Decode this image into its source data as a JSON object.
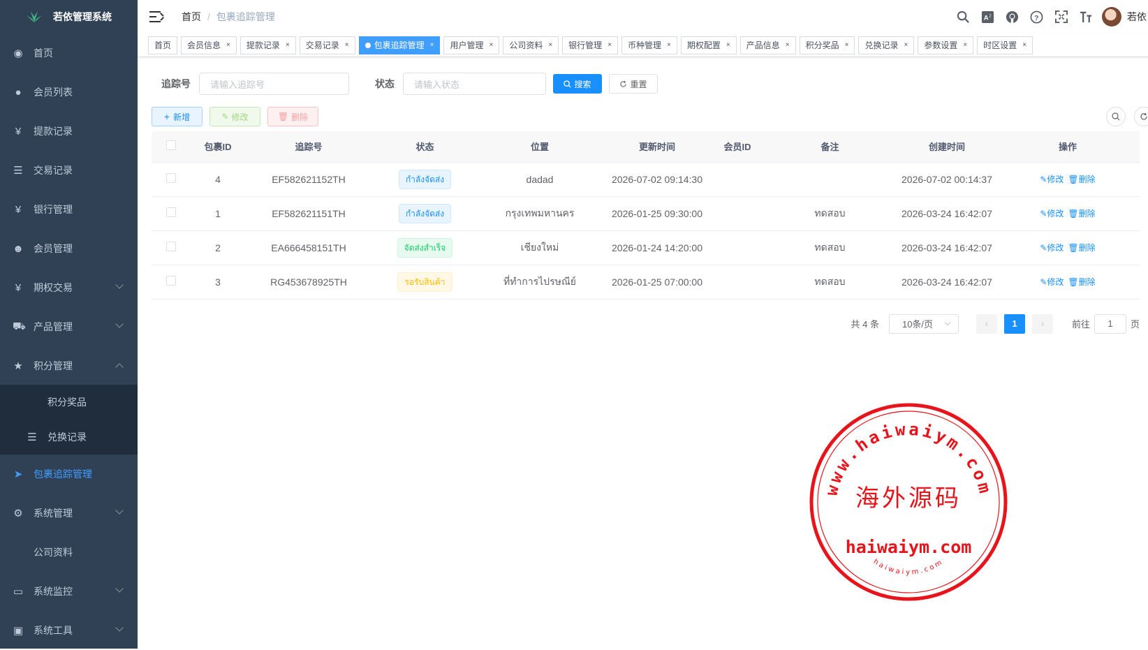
{
  "app": {
    "title": "若依管理系统"
  },
  "sidebar": {
    "items": [
      {
        "label": "首页",
        "icon": "dashboard-icon"
      },
      {
        "label": "会员列表",
        "icon": "user-icon"
      },
      {
        "label": "提款记录",
        "icon": "yen-icon"
      },
      {
        "label": "交易记录",
        "icon": "list-icon"
      },
      {
        "label": "银行管理",
        "icon": "yen-icon"
      },
      {
        "label": "会员管理",
        "icon": "peoples-icon"
      },
      {
        "label": "期权交易",
        "icon": "yen-icon"
      },
      {
        "label": "产品管理",
        "icon": "cart-icon"
      },
      {
        "label": "积分管理",
        "icon": "star-icon"
      }
    ],
    "sub": [
      {
        "label": "积分奖品"
      },
      {
        "label": "兑换记录",
        "icon": "list-icon"
      }
    ],
    "items2": [
      {
        "label": "包裹追踪管理",
        "icon": "send-icon"
      },
      {
        "label": "系统管理",
        "icon": "gear-icon"
      },
      {
        "label": "公司资料"
      },
      {
        "label": "系统监控",
        "icon": "monitor-icon"
      },
      {
        "label": "系统工具",
        "icon": "toolbox-icon"
      }
    ]
  },
  "breadcrumb": {
    "home": "首页",
    "current": "包裹追踪管理"
  },
  "user": {
    "name": "若依"
  },
  "tags": [
    "首页",
    "会员信息",
    "提款记录",
    "交易记录",
    "包裹追踪管理",
    "用户管理",
    "公司资料",
    "银行管理",
    "币种管理",
    "期权配置",
    "产品信息",
    "积分奖品",
    "兑换记录",
    "参数设置",
    "时区设置"
  ],
  "search": {
    "tracking_label": "追踪号",
    "tracking_placeholder": "请输入追踪号",
    "status_label": "状态",
    "status_placeholder": "请输入状态",
    "search_btn": "搜索",
    "reset_btn": "重置"
  },
  "toolbar": {
    "add": "新增",
    "edit": "修改",
    "delete": "删除"
  },
  "table": {
    "headers": [
      "包裹ID",
      "追踪号",
      "状态",
      "位置",
      "更新时间",
      "会员ID",
      "备注",
      "创建时间",
      "操作"
    ],
    "rows": [
      {
        "id": "4",
        "tracking": "EF582621152TH",
        "status": "กำลังจัดส่ง",
        "status_type": "info",
        "location": "dadad",
        "updated": "2026-07-02 09:14:30",
        "member": "",
        "remark": "",
        "created": "2026-07-02 00:14:37"
      },
      {
        "id": "1",
        "tracking": "EF582621151TH",
        "status": "กำลังจัดส่ง",
        "status_type": "info",
        "location": "กรุงเทพมหานคร",
        "updated": "2026-01-25 09:30:00",
        "member": "",
        "remark": "ทดสอบ",
        "created": "2026-03-24 16:42:07"
      },
      {
        "id": "2",
        "tracking": "EA666458151TH",
        "status": "จัดส่งสำเร็จ",
        "status_type": "success",
        "location": "เชียงใหม่",
        "updated": "2026-01-24 14:20:00",
        "member": "",
        "remark": "ทดสอบ",
        "created": "2026-03-24 16:42:07"
      },
      {
        "id": "3",
        "tracking": "RG453678925TH",
        "status": "รอรับสินค้า",
        "status_type": "warn",
        "location": "ที่ทำการไปรษณีย์",
        "updated": "2026-01-25 07:00:00",
        "member": "",
        "remark": "ทดสอบ",
        "created": "2026-03-24 16:42:07"
      }
    ],
    "op_edit": "修改",
    "op_delete": "删除"
  },
  "pagination": {
    "total": "共 4 条",
    "size": "10条/页",
    "current": "1",
    "goto": "前往",
    "goto_value": "1",
    "page_unit": "页"
  },
  "watermark": {
    "top_ring": "www.haiwaiym.com",
    "center": "海外源码",
    "domain": "haiwaiym.com",
    "bottom_ring": "haiwaiym.com",
    "color": "#e8141b"
  }
}
